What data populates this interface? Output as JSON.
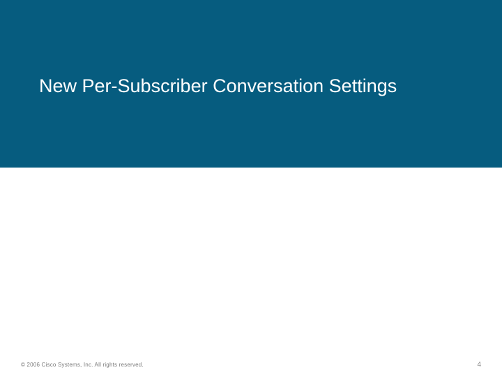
{
  "slide": {
    "title": "New Per-Subscriber Conversation Settings",
    "copyright": "© 2006 Cisco Systems, Inc. All rights reserved.",
    "page_number": "4"
  },
  "colors": {
    "header_bg": "#065c7f",
    "title_text": "#ffffff",
    "footer_text": "#808080"
  }
}
